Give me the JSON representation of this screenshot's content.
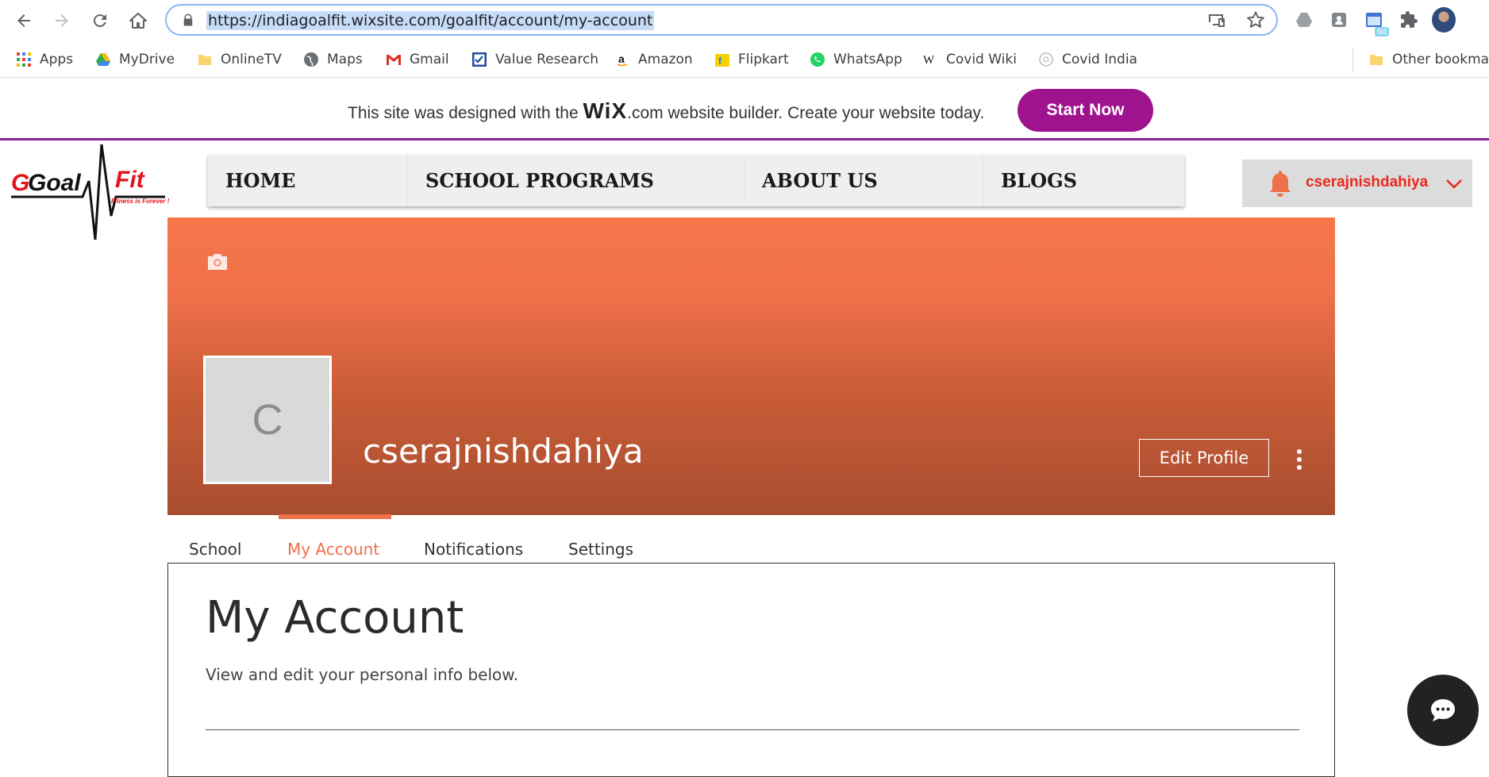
{
  "browser": {
    "url": "https://indiagoalfit.wixsite.com/goalfit/account/my-account",
    "extension_badge": "6d"
  },
  "bookmarks": {
    "items": [
      "Apps",
      "MyDrive",
      "OnlineTV",
      "Maps",
      "Gmail",
      "Value Research",
      "Amazon",
      "Flipkart",
      "WhatsApp",
      "Covid Wiki",
      "Covid India"
    ],
    "other": "Other bookmarks"
  },
  "wix_banner": {
    "text_before": "This site was designed with the",
    "logo": "WiX",
    "logo_suffix": ".com",
    "text_after": "website builder. Create your website today.",
    "button": "Start Now",
    "button_color": "#a0138e"
  },
  "site": {
    "logo_word1": "Goal",
    "logo_word2": "Fit",
    "logo_tagline": "Fitness is Forever !",
    "nav": [
      "HOME",
      "SCHOOL PROGRAMS",
      "ABOUT US",
      "BLOGS"
    ],
    "member_name": "cserajnishdahiya",
    "accent": "#f0704a"
  },
  "profile": {
    "avatar_initial": "C",
    "name": "cserajnishdahiya",
    "edit_button": "Edit Profile"
  },
  "tabs": [
    "School",
    "My Account",
    "Notifications",
    "Settings"
  ],
  "content": {
    "title": "My Account",
    "subtitle": "View and edit your personal info below."
  }
}
